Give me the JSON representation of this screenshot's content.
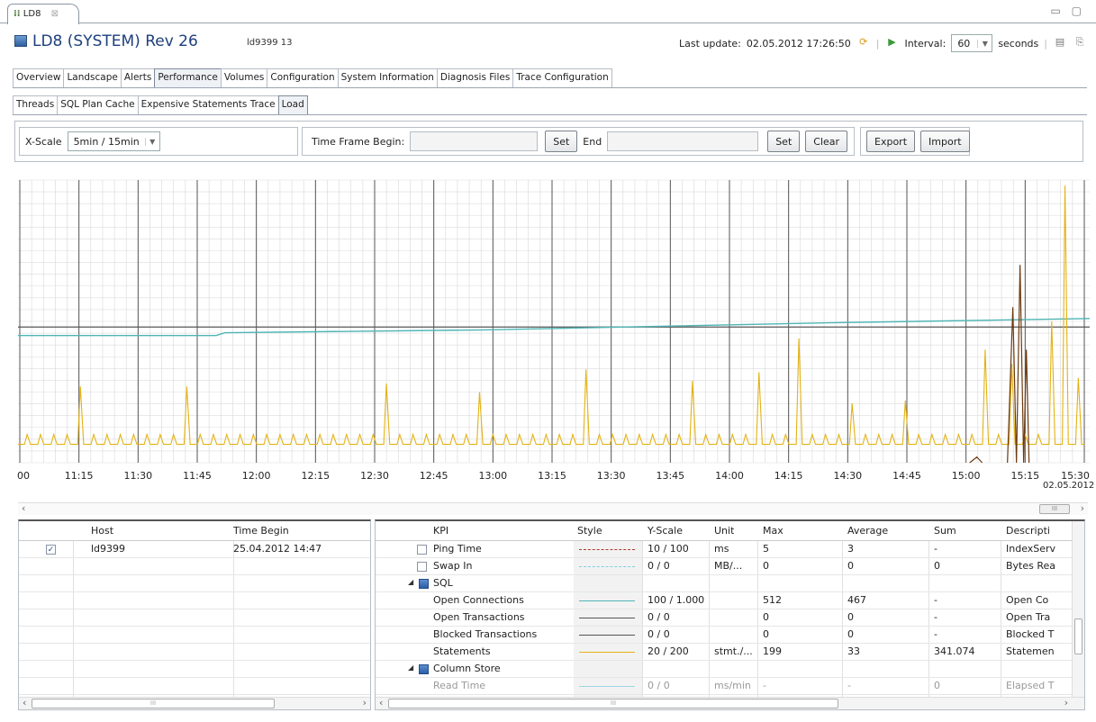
{
  "editor_tab": {
    "label": "LD8",
    "close": "⊠"
  },
  "window_controls": "▭ ▢",
  "header": {
    "title": "LD8 (SYSTEM) Rev 26",
    "host": "ld9399 13",
    "last_update_label": "Last update:",
    "last_update_value": "02.05.2012 17:26:50",
    "interval_label": "Interval:",
    "interval_value": "60",
    "interval_unit": "seconds"
  },
  "main_tabs": [
    "Overview",
    "Landscape",
    "Alerts",
    "Performance",
    "Volumes",
    "Configuration",
    "System Information",
    "Diagnosis Files",
    "Trace Configuration"
  ],
  "main_tab_active": 3,
  "sub_tabs": [
    "Threads",
    "SQL Plan Cache",
    "Expensive Statements Trace",
    "Load"
  ],
  "sub_tab_active": 3,
  "toolbar": {
    "xscale_label": "X-Scale",
    "xscale_value": "5min / 15min",
    "begin_label": "Time Frame Begin:",
    "set_label": "Set",
    "end_label": "End",
    "clear_label": "Clear",
    "export_label": "Export",
    "import_label": "Import"
  },
  "chart_data": {
    "type": "line",
    "x_ticks": [
      "00",
      "11:15",
      "11:30",
      "11:45",
      "12:00",
      "12:15",
      "12:30",
      "12:45",
      "13:00",
      "13:15",
      "13:30",
      "13:45",
      "14:00",
      "14:15",
      "14:30",
      "14:45",
      "15:00",
      "15:15",
      "15:30"
    ],
    "date_label": "02.05.2012",
    "grid": true,
    "series": [
      {
        "kpi": "Open Connections",
        "color": "#4fb5b5",
        "y_start": 0.45,
        "y_end": 0.51
      },
      {
        "kpi": "Open Transactions",
        "color": "#555555",
        "y_level": 0.48
      },
      {
        "kpi": "Statements",
        "color": "#e3b214",
        "baseline": 0.065,
        "periodic_spike": 0.1,
        "max_spike": 0.98
      },
      {
        "kpi": "Blocked Transactions",
        "color": "#6b3a10",
        "spike_at": "15:00"
      }
    ]
  },
  "host_table": {
    "columns": [
      "Host",
      "Time Begin"
    ],
    "rows": [
      {
        "checked": true,
        "host": "ld9399",
        "time_begin": "25.04.2012 14:47"
      }
    ]
  },
  "kpi_table": {
    "columns": [
      "KPI",
      "Style",
      "Y-Scale",
      "Unit",
      "Max",
      "Average",
      "Sum",
      "Descripti"
    ],
    "rows": [
      {
        "kind": "item",
        "indent": 1,
        "checkbox": true,
        "kpi": "Ping Time",
        "style": "dashed",
        "color": "#b03a2e",
        "yscale": "10 / 100",
        "unit": "ms",
        "max": "5",
        "avg": "3",
        "sum": "-",
        "desc": "IndexServ"
      },
      {
        "kind": "item",
        "indent": 1,
        "checkbox": true,
        "kpi": "Swap In",
        "style": "dashed",
        "color": "#7fd0e0",
        "yscale": "0 / 0",
        "unit": "MB/...",
        "max": "0",
        "avg": "0",
        "sum": "0",
        "desc": "Bytes Rea"
      },
      {
        "kind": "group",
        "indent": 0,
        "kpi": "SQL"
      },
      {
        "kind": "item",
        "indent": 1,
        "kpi": "Open Connections",
        "style": "solid",
        "color": "#4fb5b5",
        "yscale": "100 / 1.000",
        "unit": "",
        "max": "512",
        "avg": "467",
        "sum": "-",
        "desc": "Open Co"
      },
      {
        "kind": "item",
        "indent": 1,
        "kpi": "Open Transactions",
        "style": "solid",
        "color": "#555555",
        "yscale": "0 / 0",
        "unit": "",
        "max": "0",
        "avg": "0",
        "sum": "-",
        "desc": "Open Tra"
      },
      {
        "kind": "item",
        "indent": 1,
        "kpi": "Blocked Transactions",
        "style": "solid",
        "color": "#555555",
        "yscale": "0 / 0",
        "unit": "",
        "max": "0",
        "avg": "0",
        "sum": "-",
        "desc": "Blocked T"
      },
      {
        "kind": "item",
        "indent": 1,
        "kpi": "Statements",
        "style": "solid",
        "color": "#e3b214",
        "yscale": "20 / 200",
        "unit": "stmt./...",
        "max": "199",
        "avg": "33",
        "sum": "341.074",
        "desc": "Statemen"
      },
      {
        "kind": "group",
        "indent": 0,
        "kpi": "Column Store"
      },
      {
        "kind": "item",
        "indent": 1,
        "greyed": true,
        "kpi": "Read Time",
        "style": "solid",
        "color": "#9fd6e6",
        "yscale": "0 / 0",
        "unit": "ms/min",
        "max": "-",
        "avg": "-",
        "sum": "0",
        "desc": "Elapsed T"
      }
    ]
  },
  "scroll_glyphs": {
    "left": "‹",
    "right": "›",
    "grip": "III"
  }
}
